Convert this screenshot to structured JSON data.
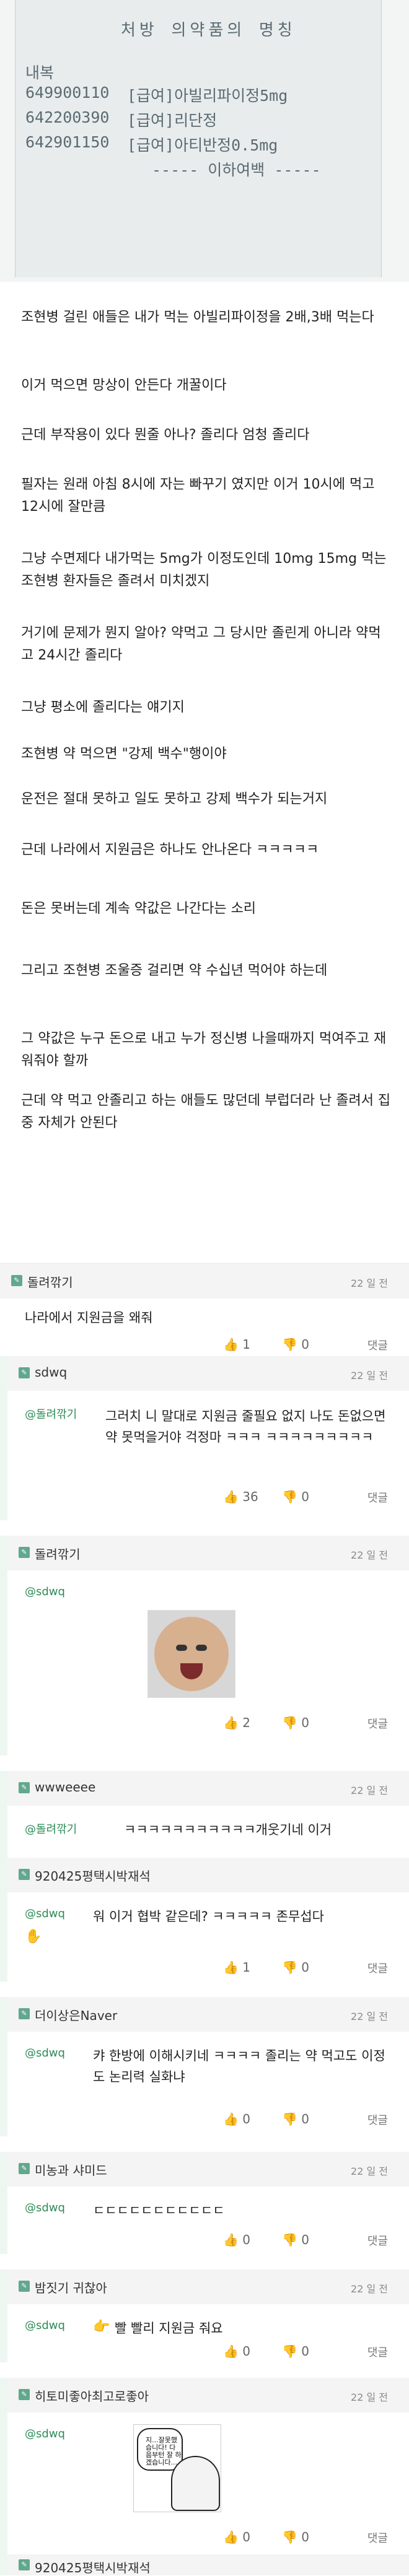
{
  "photo": {
    "header": "처방 의약품의 명칭",
    "col_label": "내복",
    "rows": [
      {
        "code": "649900110",
        "desc": "[급여]아빌리파이정5mg"
      },
      {
        "code": "642200390",
        "desc": "[급여]리단정"
      },
      {
        "code": "642901150",
        "desc": "[급여]아티반정0.5mg"
      }
    ],
    "footer": "----- 이하여백 -----"
  },
  "post": {
    "paragraphs": [
      "조현병 걸린 애들은 내가 먹는 아빌리파이정을 2배,3배 먹는다",
      "이거 먹으면 망상이 안든다 개꿀이다",
      "근데 부작용이 있다 뭔줄 아나? 졸리다 엄청 졸리다",
      "필자는 원래 아침 8시에 자는 빠꾸기 였지만 이거 10시에 먹고 12시에 잘만큼",
      "그냥 수면제다 내가먹는 5mg가 이정도인데 10mg 15mg 먹는 조현병 환자들은 졸려서 미치겠지",
      "거기에 문제가 뭔지 알아? 약먹고 그 당시만 졸린게 아니라 약먹고 24시간 졸리다",
      "그냥 평소에 졸리다는 얘기지",
      "조현병 약 먹으면 \"강제 백수\"행이야",
      "운전은 절대 못하고 일도 못하고 강제 백수가 되는거지",
      "근데 나라에서 지원금은 하나도 안나온다 ㅋㅋㅋㅋㅋ",
      "돈은 못버는데 계속 약값은 나간다는 소리",
      "그리고 조현병 조울증 걸리면 약 수십년 먹어야 하는데",
      "그 약값은 누구 돈으로 내고 누가 정신병 나을때까지 먹여주고 재워줘야 할까",
      "근데 약 먹고 안졸리고 하는 애들도 많던데 부럽더라 난 졸려서 집중 자체가 안된다"
    ]
  },
  "comments": [
    {
      "name": "돌려깎기",
      "time": "22 일 전",
      "text": "나라에서 지원금을 왜줘",
      "likes": "1",
      "dislikes": "0",
      "reply_label": "댓글"
    },
    {
      "name": "sdwq",
      "time": "22 일 전",
      "mention": "@돌려깎기",
      "text": "그러치 니 말대로 지원금 줄필요 없지 나도 돈없으면 약 못먹을거야 걱정마 ㅋㅋㅋ ㅋㅋㅋㅋㅋㅋㅋㅋㅋ",
      "likes": "36",
      "dislikes": "0",
      "reply_label": "댓글"
    },
    {
      "name": "돌려깎기",
      "time": "22 일 전",
      "mention": "@sdwq",
      "text": "",
      "likes": "2",
      "dislikes": "0",
      "reply_label": "댓글"
    },
    {
      "name": "wwweeee",
      "time": "22 일 전",
      "mention": "@돌려깎기",
      "text": "ㅋㅋㅋㅋㅋㅋㅋㅋㅋㅋㅋ개웃기네 이거",
      "likes": "",
      "dislikes": "",
      "reply_label": ""
    },
    {
      "name": "920425평택시박재석",
      "time": "",
      "mention": "@sdwq",
      "text": "워 이거 협박 같은데? ㅋㅋㅋㅋㅋ 존무섭다",
      "likes": "1",
      "dislikes": "0",
      "reply_label": "댓글"
    },
    {
      "name": "더이상은Naver",
      "time": "22 일 전",
      "mention": "@sdwq",
      "text": "캬 한방에 이해시키네 ㅋㅋㅋㅋ 졸리는 약 먹고도 이정도 논리력 실화냐",
      "likes": "0",
      "dislikes": "0",
      "reply_label": "댓글"
    },
    {
      "name": "미농과 샤미드",
      "time": "22 일 전",
      "mention": "@sdwq",
      "text": "ㄷㄷㄷㄷㄷㄷㄷㄷㄷㄷㄷ",
      "likes": "0",
      "dislikes": "0",
      "reply_label": "댓글"
    },
    {
      "name": "밤짓기 귀찮아",
      "time": "22 일 전",
      "mention": "@sdwq",
      "text": "빨 빨리 지원금 줘요",
      "likes": "0",
      "dislikes": "0",
      "reply_label": "댓글"
    },
    {
      "name": "히토미좋아최고로좋아",
      "time": "22 일 전",
      "mention": "@sdwq",
      "text": "",
      "sticker": {
        "text": "지...잘못했습니다! 다음부턴 잘 하겠습니다..."
      },
      "likes": "0",
      "dislikes": "0",
      "reply_label": "댓글"
    },
    {
      "name": "920425평택시박재석",
      "time": "",
      "mention": "",
      "text": "",
      "likes": "",
      "dislikes": "",
      "reply_label": ""
    }
  ]
}
